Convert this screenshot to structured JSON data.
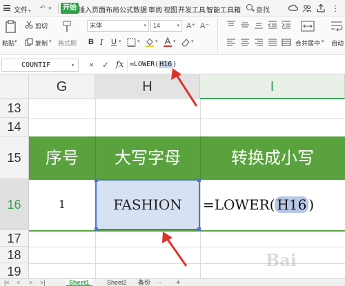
{
  "menubar": {
    "file_label": "文件",
    "tabs": [
      "开始",
      "插入",
      "页面布局",
      "公式",
      "数据",
      "审阅",
      "视图",
      "开发工具",
      "智能工具箱"
    ],
    "search_label": "查找"
  },
  "ribbon": {
    "paste_label": "粘贴",
    "cut_label": "剪切",
    "copy_label": "复制",
    "format_painter_label": "格式刷",
    "font_name": "宋体",
    "font_size": "14",
    "bold_label": "B",
    "italic_label": "I",
    "underline_label": "U",
    "font_grow": "A⁺",
    "font_shrink": "A⁻",
    "merge_center_label": "合并居中",
    "wrap_label": "自动"
  },
  "formula_bar": {
    "name_box": "COUNTIF",
    "cancel_symbol": "×",
    "confirm_symbol": "✓",
    "fx_label": "fx",
    "formula_prefix": "=LOWER(",
    "formula_ref": "H16",
    "formula_suffix": ")"
  },
  "grid": {
    "columns": [
      "G",
      "H",
      "I"
    ],
    "rows": [
      "13",
      "14",
      "15",
      "16",
      "17",
      "18",
      "19"
    ],
    "row15": {
      "G": "序号",
      "H": "大写字母",
      "I": "转换成小写"
    },
    "row16": {
      "G": "1",
      "H": "FASHION",
      "I_prefix": "=LOWER(",
      "I_ref": "H16",
      "I_suffix": ")"
    }
  },
  "sheet_tabs": {
    "tabs": [
      "Sheet1",
      "Sheet2",
      "备份"
    ],
    "add_symbol": "+",
    "more_symbol": "···"
  },
  "watermark": "Bai",
  "colors": {
    "accent_green": "#2ba246",
    "table_header_green": "#5aa23e",
    "selection_blue": "#4f75c8",
    "arrow_red": "#e0302a"
  }
}
